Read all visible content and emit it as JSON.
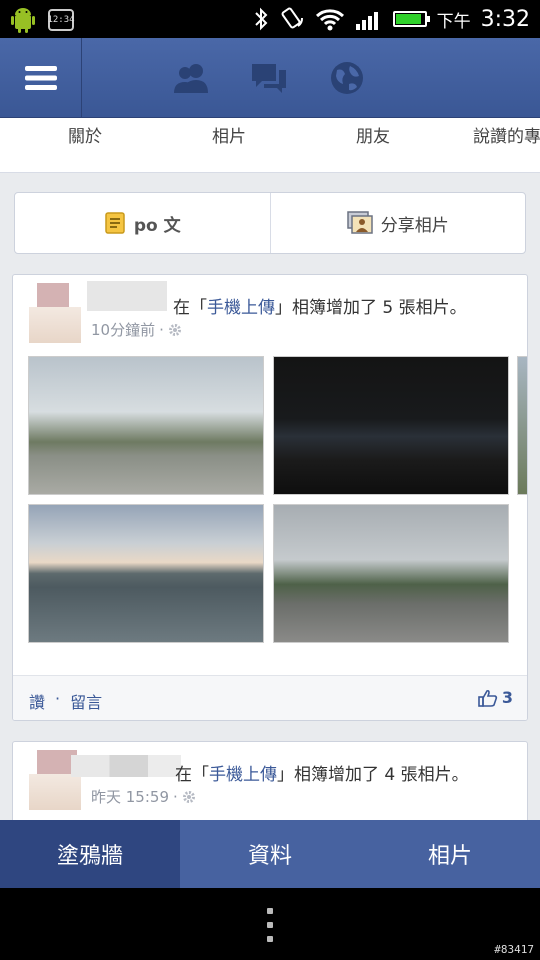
{
  "status_bar": {
    "clock_widget_text": "12:34",
    "ampm": "下午",
    "time": "3:32",
    "battery_level": 0.9
  },
  "header": {
    "icons": [
      "menu-icon",
      "friend-requests-icon",
      "messages-icon",
      "notifications-globe-icon"
    ]
  },
  "profile_tabs": {
    "items": [
      {
        "label": "關於"
      },
      {
        "label": "相片"
      },
      {
        "label": "朋友"
      },
      {
        "label": "說讚的專"
      }
    ]
  },
  "composer": {
    "post_label": "po 文",
    "share_photo_label": "分享相片"
  },
  "posts": [
    {
      "pre_text": "在「",
      "album_name": "手機上傳",
      "post_text": "」相簿增加了 5 張相片。",
      "timestamp": "10分鐘前",
      "separator": "·",
      "actions": {
        "like": "讚",
        "dot": "·",
        "comment": "留言"
      },
      "like_count": "3"
    },
    {
      "pre_text": "在「",
      "album_name": "手機上傳",
      "post_text": "」相簿增加了 4 張相片。",
      "timestamp": "昨天 15:59",
      "separator": "·"
    }
  ],
  "bottom_nav": {
    "items": [
      {
        "label": "塗鴉牆",
        "active": true
      },
      {
        "label": "資料",
        "active": false
      },
      {
        "label": "相片",
        "active": false
      }
    ]
  },
  "watermark": "#83417",
  "colors": {
    "fb_blue": "#3b5998",
    "header_bg": "#4a68a8",
    "bottom_nav_bg": "#4762a0",
    "bottom_nav_active": "#2f4680",
    "feed_bg": "#e9ebee"
  }
}
